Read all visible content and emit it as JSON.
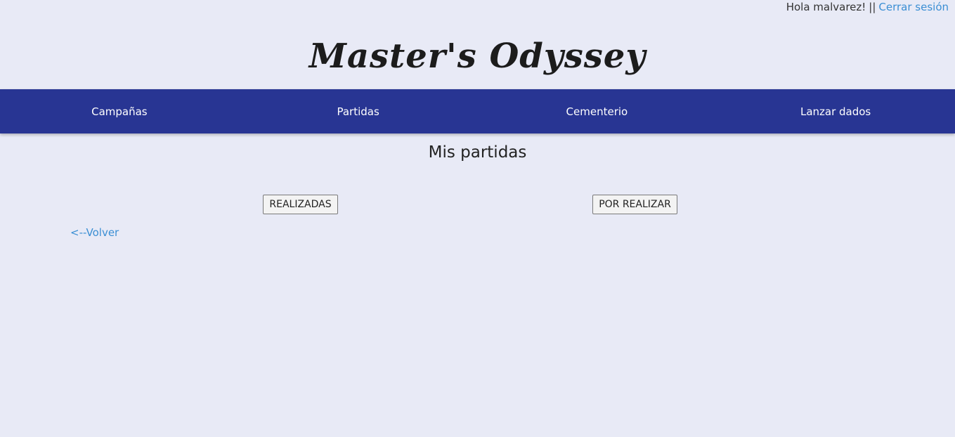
{
  "header": {
    "greeting": "Hola malvarez!",
    "separator": "||",
    "logout_label": "Cerrar sesión",
    "site_title": "Master's Odyssey"
  },
  "nav": {
    "items": [
      {
        "label": "Campañas"
      },
      {
        "label": "Partidas"
      },
      {
        "label": "Cementerio"
      },
      {
        "label": "Lanzar dados"
      }
    ]
  },
  "main": {
    "title": "Mis partidas",
    "done_button": "REALIZADAS",
    "pending_button": "POR REALIZAR",
    "back_link": "<--Volver"
  },
  "colors": {
    "page_background": "#e8eaf6",
    "navbar": "#283593",
    "link": "#3b8fd4"
  }
}
